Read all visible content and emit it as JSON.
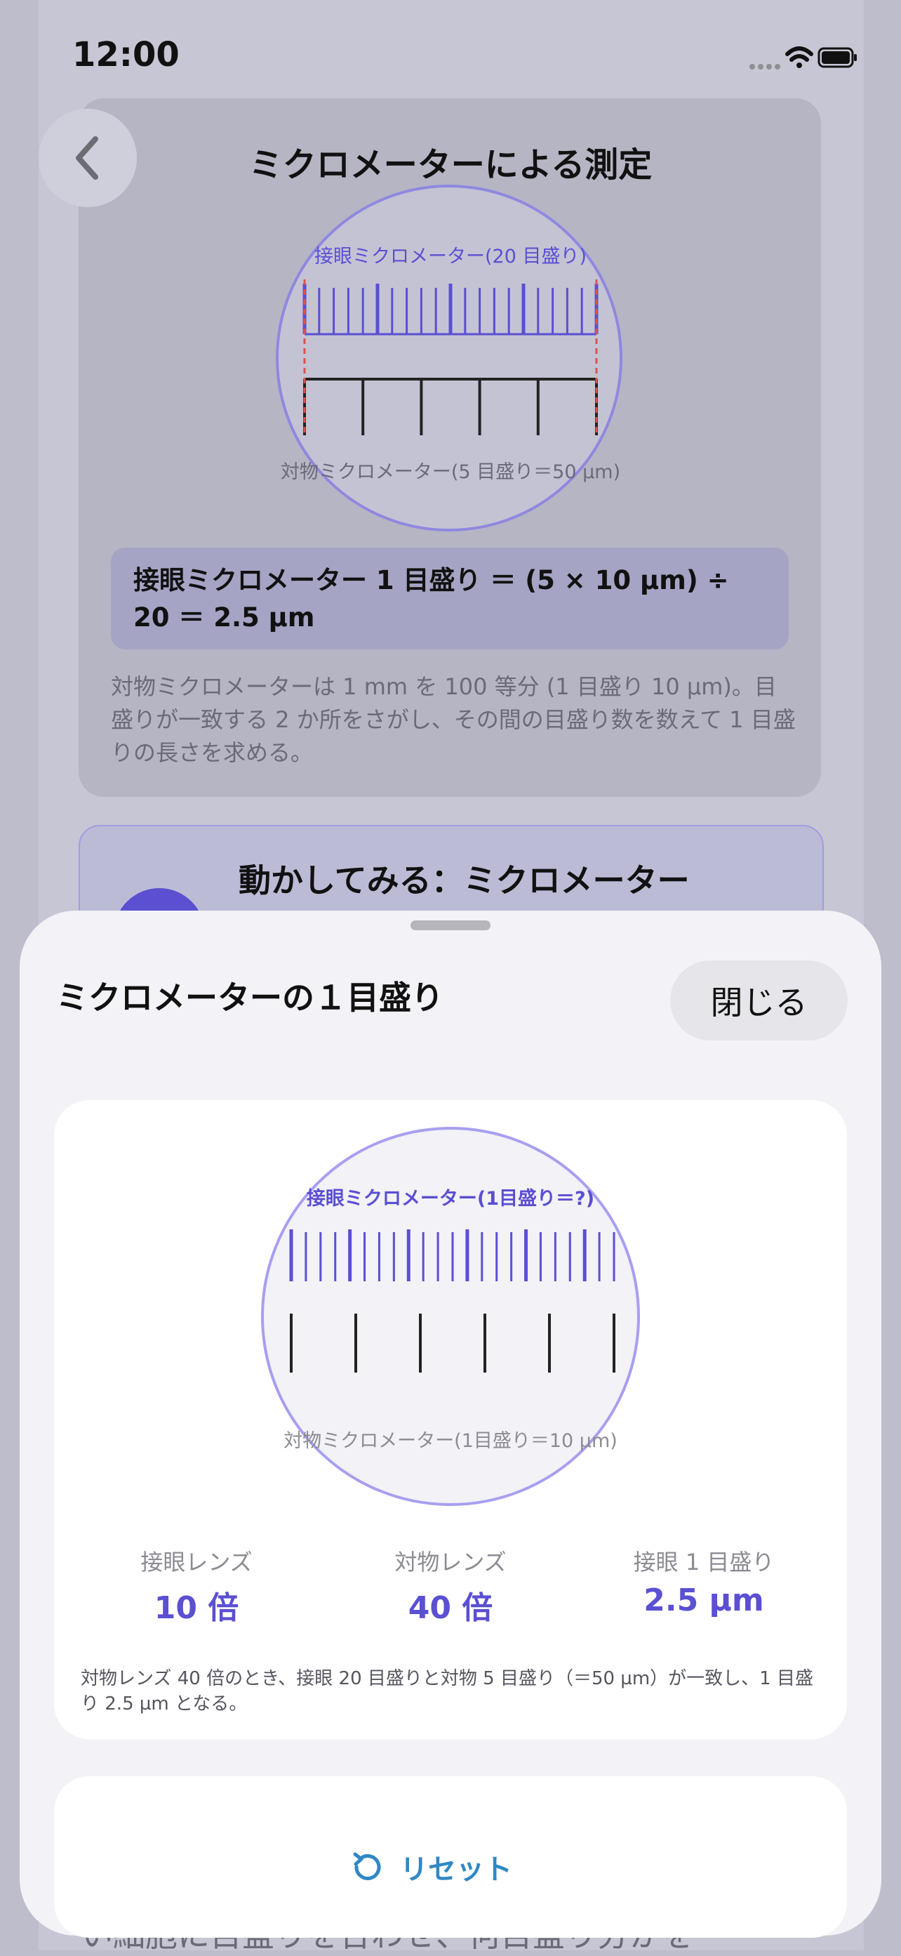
{
  "status": {
    "time": "12:00"
  },
  "background": {
    "nav_title": "ミクロメーターによる測定",
    "diagram": {
      "eyepiece_label": "接眼ミクロメーター(20 目盛り)",
      "objective_label": "対物ミクロメーター(5 目盛り＝50 µm)"
    },
    "formula": "接眼ミクロメーター 1 目盛り ＝ (5 × 10 µm) ÷ 20 ＝ 2.5 µm",
    "description": "対物ミクロメーターは 1 mm を 100 等分 (1 目盛り 10 µm)。目盛りが一致する 2 か所をさがし、その間の目盛り数を数えて 1 目盛りの長さを求める。",
    "next_card_title": "動かしてみる：ミクロメーター",
    "bottom_text": "い細胞に目盛りを合わせ、何目盛り分かを"
  },
  "sheet": {
    "title": "ミクロメーターの１目盛り",
    "close_label": "閉じる",
    "scope": {
      "eyepiece_label": "接眼ミクロメーター(1目盛り＝?)",
      "objective_label": "対物ミクロメーター(1目盛り＝10 µm)"
    },
    "stats": [
      {
        "label": "接眼レンズ",
        "value": "10 倍"
      },
      {
        "label": "対物レンズ",
        "value": "40 倍"
      },
      {
        "label": "接眼 1 目盛り",
        "value": "2.5 µm"
      }
    ],
    "note": "対物レンズ 40 倍のとき、接眼 20 目盛りと対物 5 目盛り（＝50 µm）が一致し、1 目盛り 2.5 µm となる。",
    "reset_label": "リセット"
  },
  "colors": {
    "accent": "#5b4fd2",
    "link": "#2f88c4"
  }
}
